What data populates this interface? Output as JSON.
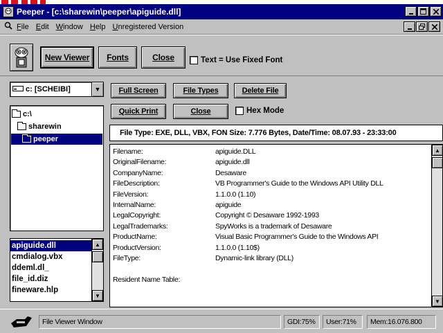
{
  "window": {
    "title": "Peeper - [c:\\sharewin\\peeper\\apiguide.dll]",
    "controls": [
      "minimize",
      "maximize",
      "close"
    ]
  },
  "menu": {
    "items": [
      "File",
      "Edit",
      "Window",
      "Help",
      "Unregistered Version"
    ]
  },
  "toolbar": {
    "new_viewer": "New Viewer",
    "fonts": "Fonts",
    "close": "Close",
    "fixed_font_label": "Text = Use Fixed Font",
    "fixed_font_checked": false
  },
  "drive": {
    "value": "c: [SCHEIBI]"
  },
  "actions": {
    "full_screen": "Full Screen",
    "file_types": "File Types",
    "delete_file": "Delete File",
    "quick_print": "Quick Print",
    "close": "Close",
    "hex_mode_label": "Hex Mode",
    "hex_mode_checked": false
  },
  "dirtree": {
    "items": [
      {
        "label": "c:\\",
        "selected": false
      },
      {
        "label": "sharewin",
        "selected": false
      },
      {
        "label": "peeper",
        "selected": true
      }
    ]
  },
  "files": {
    "items": [
      "apiguide.dll",
      "cmdialog.vbx",
      "ddeml.dl_",
      "file_id.diz",
      "fineware.hlp"
    ],
    "selected": "apiguide.dll"
  },
  "filetype_bar": "File Type: EXE, DLL, VBX, FON   Size: 7.776 Bytes, Date/Time: 08.07.93 - 23:33:00",
  "viewer": {
    "rows": [
      {
        "key": "Filename:",
        "value": "apiguide.DLL"
      },
      {
        "key": "OriginalFilename:",
        "value": "apiguide.dll"
      },
      {
        "key": "CompanyName:",
        "value": "Desaware"
      },
      {
        "key": "FileDescription:",
        "value": "VB Programmer's Guide to the Windows API Utility DLL"
      },
      {
        "key": "FileVersion:",
        "value": "1.1.0.0 (1.10)"
      },
      {
        "key": "InternalName:",
        "value": "apiguide"
      },
      {
        "key": "LegalCopyright:",
        "value": "Copyright © Desaware 1992-1993"
      },
      {
        "key": "LegalTrademarks:",
        "value": "SpyWorks is a trademark of Desaware"
      },
      {
        "key": "ProductName:",
        "value": "Visual Basic Programmer's Guide to the Windows API"
      },
      {
        "key": "ProductVersion:",
        "value": "1.1.0.0 (1.10$)"
      },
      {
        "key": "FileType:",
        "value": "Dynamic-link library (DLL)"
      },
      {
        "key": "",
        "value": ""
      },
      {
        "key": "Resident Name Table:",
        "value": ""
      },
      {
        "key": "",
        "value": ""
      }
    ]
  },
  "status": {
    "text": "File Viewer Window",
    "gdi": "GDI:75%",
    "user": "User:71%",
    "mem": "Mem:16.076.800"
  },
  "colors": {
    "titlebar": "#000080",
    "face": "#c0c0c0",
    "selection": "#000080",
    "accent_red": "#ff0000"
  }
}
